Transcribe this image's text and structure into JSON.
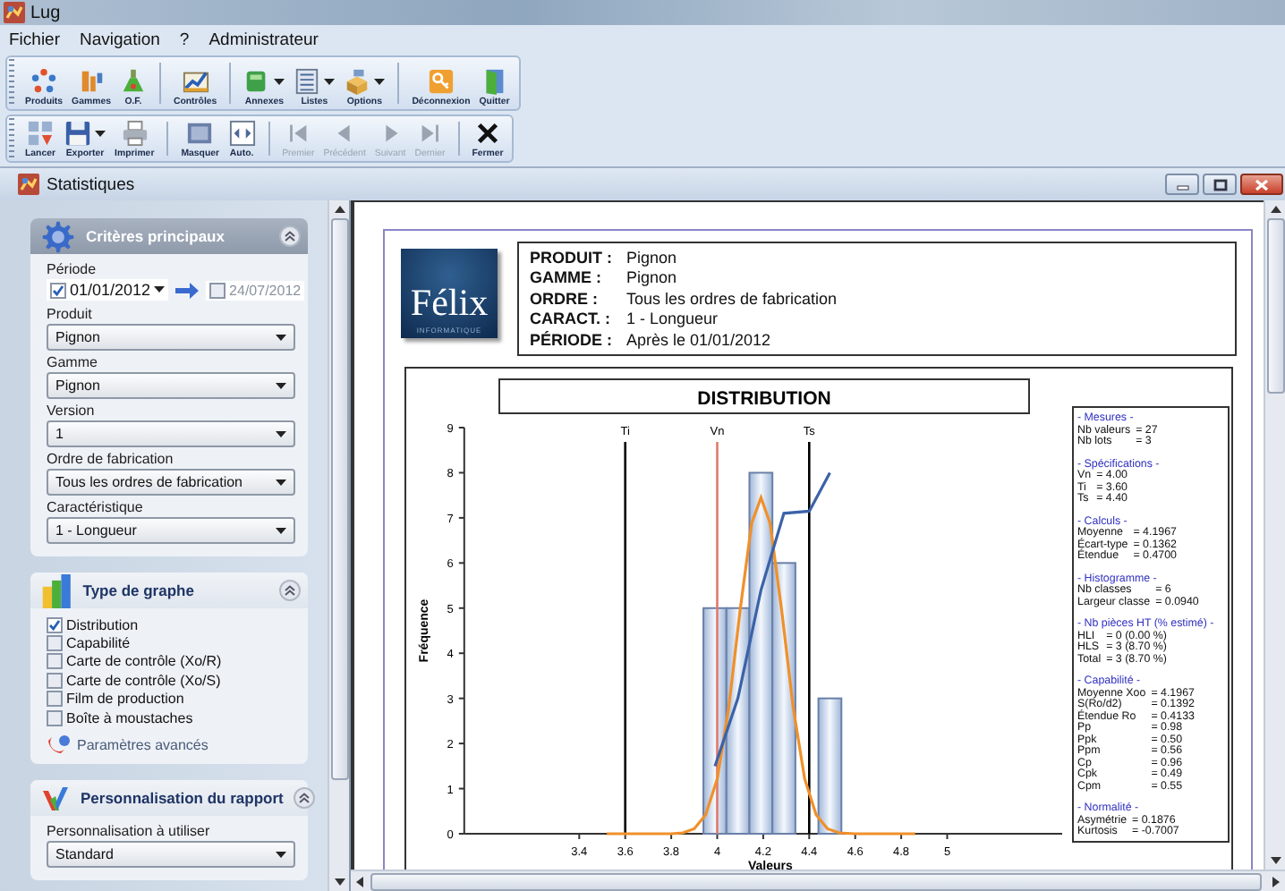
{
  "window": {
    "title": "Lug"
  },
  "menu": [
    "Fichier",
    "Navigation",
    "?",
    "Administrateur"
  ],
  "toolbars": [
    {
      "groups": [
        [
          {
            "label": "Produits",
            "kind": "produits",
            "dropdown": false,
            "disabled": false
          },
          {
            "label": "Gammes",
            "kind": "gammes",
            "dropdown": false,
            "disabled": false
          },
          {
            "label": "O.F.",
            "kind": "of",
            "dropdown": false,
            "disabled": false
          }
        ],
        [
          {
            "label": "Contrôles",
            "kind": "controles",
            "dropdown": false,
            "disabled": false
          }
        ],
        [
          {
            "label": "Annexes",
            "kind": "annexes",
            "dropdown": true,
            "disabled": false
          },
          {
            "label": "Listes",
            "kind": "listes",
            "dropdown": true,
            "disabled": false
          },
          {
            "label": "Options",
            "kind": "options",
            "dropdown": true,
            "disabled": false
          }
        ],
        [
          {
            "label": "Déconnexion",
            "kind": "deconnexion",
            "dropdown": false,
            "disabled": false
          },
          {
            "label": "Quitter",
            "kind": "quitter",
            "dropdown": false,
            "disabled": false
          }
        ]
      ]
    },
    {
      "groups": [
        [
          {
            "label": "Lancer",
            "kind": "lancer",
            "dropdown": false,
            "disabled": false
          },
          {
            "label": "Exporter",
            "kind": "exporter",
            "dropdown": true,
            "disabled": false
          },
          {
            "label": "Imprimer",
            "kind": "imprimer",
            "dropdown": false,
            "disabled": false
          }
        ],
        [
          {
            "label": "Masquer",
            "kind": "masquer",
            "dropdown": false,
            "disabled": false
          },
          {
            "label": "Auto.",
            "kind": "auto",
            "dropdown": false,
            "disabled": false
          }
        ],
        [
          {
            "label": "Premier",
            "kind": "premier",
            "dropdown": false,
            "disabled": true
          },
          {
            "label": "Précédent",
            "kind": "precedent",
            "dropdown": false,
            "disabled": true
          },
          {
            "label": "Suivant",
            "kind": "suivant",
            "dropdown": false,
            "disabled": true
          },
          {
            "label": "Dernier",
            "kind": "dernier",
            "dropdown": false,
            "disabled": true
          }
        ],
        [
          {
            "label": "Fermer",
            "kind": "fermer",
            "dropdown": false,
            "disabled": false
          }
        ]
      ]
    }
  ],
  "document": {
    "title": "Statistiques"
  },
  "sidebar": {
    "panels": [
      {
        "title": "Critères principaux",
        "kind": "criteria",
        "active": true,
        "fields": [
          {
            "kind": "period",
            "label": "Période",
            "from": {
              "checked": true,
              "value": "01/01/2012"
            },
            "to": {
              "checked": false,
              "value": "24/07/2012"
            }
          },
          {
            "kind": "select",
            "label": "Produit",
            "value": "Pignon"
          },
          {
            "kind": "select",
            "label": "Gamme",
            "value": "Pignon"
          },
          {
            "kind": "select",
            "label": "Version",
            "value": "1"
          },
          {
            "kind": "select",
            "label": "Ordre de fabrication",
            "value": "Tous les ordres de fabrication"
          },
          {
            "kind": "select",
            "label": "Caractéristique",
            "value": "1 - Longueur"
          }
        ]
      },
      {
        "title": "Type de graphe",
        "kind": "graph",
        "active": false,
        "fields": [
          {
            "kind": "checkbox",
            "label": "Distribution",
            "checked": true
          },
          {
            "kind": "checkbox",
            "label": "Capabilité",
            "checked": false
          },
          {
            "kind": "checkbox",
            "label": "Carte de contrôle (Xo/R)",
            "checked": false
          },
          {
            "kind": "checkbox",
            "label": "Carte de contrôle (Xo/S)",
            "checked": false
          },
          {
            "kind": "checkbox",
            "label": "Film de production",
            "checked": false
          },
          {
            "kind": "checkbox",
            "label": "Boîte à moustaches",
            "checked": false
          },
          {
            "kind": "link",
            "label": "Paramètres avancés"
          }
        ]
      },
      {
        "title": "Personnalisation du rapport",
        "kind": "report",
        "active": false,
        "fields": [
          {
            "kind": "select",
            "label": "Personnalisation à utiliser",
            "value": "Standard"
          }
        ]
      }
    ]
  },
  "report": {
    "logo": {
      "name": "Félix",
      "tagline": "INFORMATIQUE"
    },
    "header": [
      {
        "label": "PRODUIT :",
        "value": "Pignon"
      },
      {
        "label": "GAMME :",
        "value": "Pignon"
      },
      {
        "label": "ORDRE :",
        "value": "Tous les ordres de fabrication"
      },
      {
        "label": "CARACT. :",
        "value": "1 - Longueur"
      },
      {
        "label": "PÉRIODE :",
        "value": "Après le 01/01/2012"
      }
    ],
    "chart_data": {
      "type": "bar",
      "title": "DISTRIBUTION",
      "xlabel": "Valeurs",
      "ylabel": "Fréquence",
      "x": [
        3.99,
        4.09,
        4.19,
        4.29,
        4.49
      ],
      "series": [
        {
          "type": "bar",
          "color": "#6a80a8",
          "values": [
            5,
            5,
            8,
            6,
            3
          ]
        },
        {
          "type": "line",
          "color": "#f0902a",
          "x": [
            3.52,
            3.7,
            3.8,
            3.85,
            3.9,
            3.95,
            4.0,
            4.05,
            4.1,
            4.15,
            4.19,
            4.23,
            4.28,
            4.33,
            4.38,
            4.43,
            4.48,
            4.53,
            4.6,
            4.7,
            4.86
          ],
          "values": [
            0,
            0,
            0,
            0.02,
            0.11,
            0.42,
            1.22,
            2.8,
            4.97,
            6.88,
            7.45,
            6.88,
            4.97,
            2.8,
            1.22,
            0.42,
            0.11,
            0.02,
            0,
            0,
            0
          ]
        },
        {
          "type": "line",
          "color": "#3b62a8",
          "x": [
            3.99,
            4.09,
            4.19,
            4.29,
            4.4,
            4.49
          ],
          "values": [
            1.5,
            3.0,
            5.4,
            7.1,
            7.15,
            8.0
          ]
        }
      ],
      "xlim": [
        2.9,
        5.5
      ],
      "ylim": [
        0,
        9
      ],
      "xticks": [
        3.4,
        3.6,
        3.8,
        4,
        4.2,
        4.4,
        4.6,
        4.8,
        5
      ],
      "yticks": [
        0,
        1,
        2,
        3,
        4,
        5,
        6,
        7,
        8,
        9
      ],
      "ref_lines": [
        {
          "axis": "x",
          "value": 3.6,
          "label": "Ti",
          "color": "#000000"
        },
        {
          "axis": "x",
          "value": 4.0,
          "label": "Vn",
          "color": "#e07a6e"
        },
        {
          "axis": "x",
          "value": 4.4,
          "label": "Ts",
          "color": "#000000"
        }
      ]
    },
    "stats": [
      {
        "title": "- Mesures -",
        "rows": [
          {
            "label": "Nb valeurs",
            "value": "= 27"
          },
          {
            "label": "Nb lots",
            "value": "= 3"
          }
        ]
      },
      {
        "title": "- Spécifications -",
        "rows": [
          {
            "label": "Vn",
            "value": "= 4.00"
          },
          {
            "label": "Ti",
            "value": "= 3.60"
          },
          {
            "label": "Ts",
            "value": "= 4.40"
          }
        ]
      },
      {
        "title": "- Calculs -",
        "rows": [
          {
            "label": "Moyenne",
            "value": "= 4.1967"
          },
          {
            "label": "Écart-type",
            "value": "= 0.1362"
          },
          {
            "label": "Étendue",
            "value": "= 0.4700"
          }
        ]
      },
      {
        "title": "- Histogramme -",
        "rows": [
          {
            "label": "Nb classes",
            "value": "= 6"
          },
          {
            "label": "Largeur classe",
            "value": "= 0.0940"
          }
        ]
      },
      {
        "title": "- Nb pièces HT (% estimé) -",
        "rows": [
          {
            "label": "HLI",
            "value": "= 0 (0.00 %)"
          },
          {
            "label": "HLS",
            "value": "= 3 (8.70 %)"
          },
          {
            "label": "Total",
            "value": "= 3 (8.70 %)"
          }
        ]
      },
      {
        "title": "- Capabilité -",
        "rows": [
          {
            "label": "Moyenne Xoo",
            "value": "= 4.1967"
          },
          {
            "label": "S(Ro/d2)",
            "value": "= 0.1392"
          },
          {
            "label": "Étendue Ro",
            "value": "= 0.4133"
          },
          {
            "label": "Pp",
            "value": "= 0.98"
          },
          {
            "label": "Ppk",
            "value": "= 0.50"
          },
          {
            "label": "Ppm",
            "value": "= 0.56"
          },
          {
            "label": "Cp",
            "value": "= 0.96"
          },
          {
            "label": "Cpk",
            "value": "= 0.49"
          },
          {
            "label": "Cpm",
            "value": "= 0.55"
          }
        ]
      },
      {
        "title": "- Normalité -",
        "rows": [
          {
            "label": "Asymétrie",
            "value": "= 0.1876"
          },
          {
            "label": "Kurtosis",
            "value": "= -0.7007"
          }
        ]
      }
    ]
  }
}
